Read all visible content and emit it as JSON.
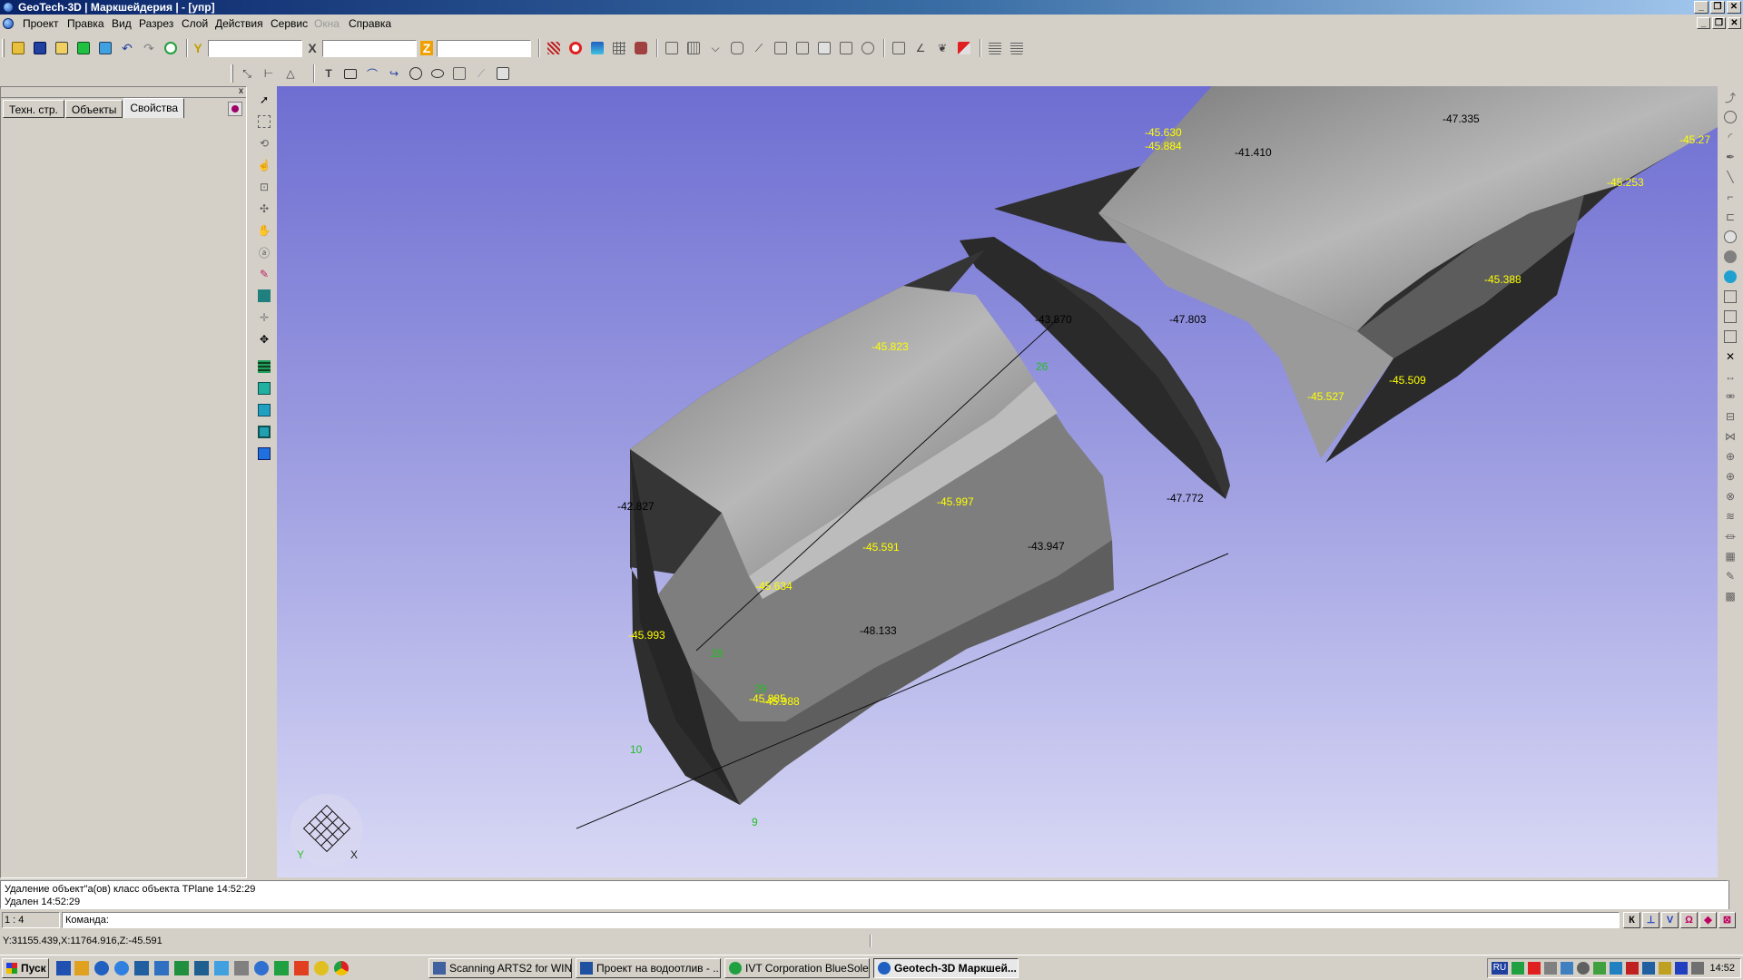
{
  "window": {
    "title": "GeoTech-3D | Маркшейдерия | - [упр]"
  },
  "menu": {
    "items": [
      "Проект",
      "Правка",
      "Вид",
      "Разрез",
      "Слой",
      "Действия",
      "Сервис",
      "Окна",
      "Справка"
    ],
    "disabled": [
      "Окна"
    ]
  },
  "coords": {
    "y_label": "Y",
    "x_label": "X",
    "z_label": "Z",
    "y_value": "",
    "x_value": "",
    "z_value": ""
  },
  "panel": {
    "tabs": [
      "Техн. стр.",
      "Объекты",
      "Свойства"
    ],
    "active_tab": "Свойства",
    "close": "x"
  },
  "viewport": {
    "elevation_labels": [
      {
        "text": "-45.630",
        "color": "#ffff00"
      },
      {
        "text": "-45.884",
        "color": "#ffff00"
      },
      {
        "text": "-41.410",
        "color": "#000000"
      },
      {
        "text": "-47.335",
        "color": "#000000"
      },
      {
        "text": "-45.27",
        "color": "#ffff00"
      },
      {
        "text": "-45.253",
        "color": "#ffff00"
      },
      {
        "text": "-45.388",
        "color": "#ffff00"
      },
      {
        "text": "-47.803",
        "color": "#000000"
      },
      {
        "text": "-45.509",
        "color": "#ffff00"
      },
      {
        "text": "-45.527",
        "color": "#ffff00"
      },
      {
        "text": "-45.823",
        "color": "#ffff00"
      },
      {
        "text": "-43.870",
        "color": "#000000"
      },
      {
        "text": "-42.827",
        "color": "#000000"
      },
      {
        "text": "-45.997",
        "color": "#ffff00"
      },
      {
        "text": "-47.772",
        "color": "#000000"
      },
      {
        "text": "-45.591",
        "color": "#ffff00"
      },
      {
        "text": "-43.947",
        "color": "#000000"
      },
      {
        "text": "-45.634",
        "color": "#ffff00"
      },
      {
        "text": "-48.133",
        "color": "#000000"
      },
      {
        "text": "-45.993",
        "color": "#ffff00"
      },
      {
        "text": "-45.885",
        "color": "#ffff00"
      },
      {
        "text": "-45.988",
        "color": "#ffff00"
      }
    ],
    "point_ids": [
      "26",
      "28",
      "29",
      "10",
      "9"
    ],
    "axes": {
      "y": "Y",
      "x": "X"
    }
  },
  "log": {
    "lines": [
      "Удаление объект\"а(ов) класс объекта TPlane 14:52:29",
      "Удален 14:52:29"
    ]
  },
  "command": {
    "scale": "1 : 4",
    "prompt": "Команда:",
    "buttons": [
      "К",
      "⊥",
      "V",
      "Ω",
      "◆",
      "⊠"
    ]
  },
  "status": {
    "cursor": "Y:31155.439,X:11764.916,Z:-45.591"
  },
  "taskbar": {
    "start": "Пуск",
    "tasks": [
      "Scanning ARTS2 for WIN",
      "Проект на водоотлив - ...",
      "IVT Corporation BlueSole...",
      "Geotech-3D Маркшей..."
    ],
    "active_task": "Geotech-3D Маркшей...",
    "lang": "RU",
    "clock": "14:52"
  },
  "colors": {
    "title_start": "#0a246a",
    "viewport_top": "#6e6ed2",
    "viewport_bottom": "#d8d8f4",
    "label_yellow": "#ffff00",
    "point_green": "#22c022"
  }
}
